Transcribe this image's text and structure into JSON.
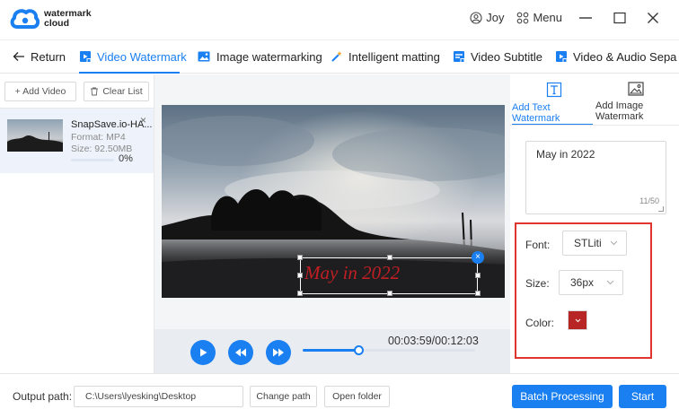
{
  "app": {
    "logo_line1": "watermark",
    "logo_line2": "cloud",
    "user_label": "Joy",
    "menu_label": "Menu"
  },
  "tabs": [
    {
      "label": "Return"
    },
    {
      "label": "Video Watermark"
    },
    {
      "label": "Image watermarking"
    },
    {
      "label": "Intelligent matting"
    },
    {
      "label": "Video Subtitle"
    },
    {
      "label": "Video & Audio Sepa"
    }
  ],
  "left": {
    "add_video_label": "+ Add Video",
    "clear_list_label": "Clear List",
    "file": {
      "name": "SnapSave.io-HA...",
      "format": "Format:  MP4",
      "size": "Size:  92.50MB",
      "progress_text": "0%",
      "progress": 0
    }
  },
  "preview": {
    "watermark_text": "May in 2022"
  },
  "player": {
    "timecode": "00:03:59/00:12:03",
    "position_fraction": 0.33
  },
  "right": {
    "tab_text": "Add Text Watermark",
    "tab_image": "Add Image Watermark",
    "text_value": "May in 2022",
    "char_count": "11/50",
    "font_label": "Font:",
    "font_value": "STLiti",
    "size_label": "Size:",
    "size_value": "36px",
    "color_label": "Color:",
    "color_value": "#b82525"
  },
  "bottom": {
    "output_label": "Output path:",
    "output_path": "C:\\Users\\lyesking\\Desktop",
    "change_path_label": "Change path",
    "open_folder_label": "Open folder",
    "batch_label": "Batch Processing",
    "start_label": "Start"
  },
  "colors": {
    "accent": "#1a7ff0",
    "highlight_border": "#e0342e",
    "watermark": "#c01e22"
  }
}
